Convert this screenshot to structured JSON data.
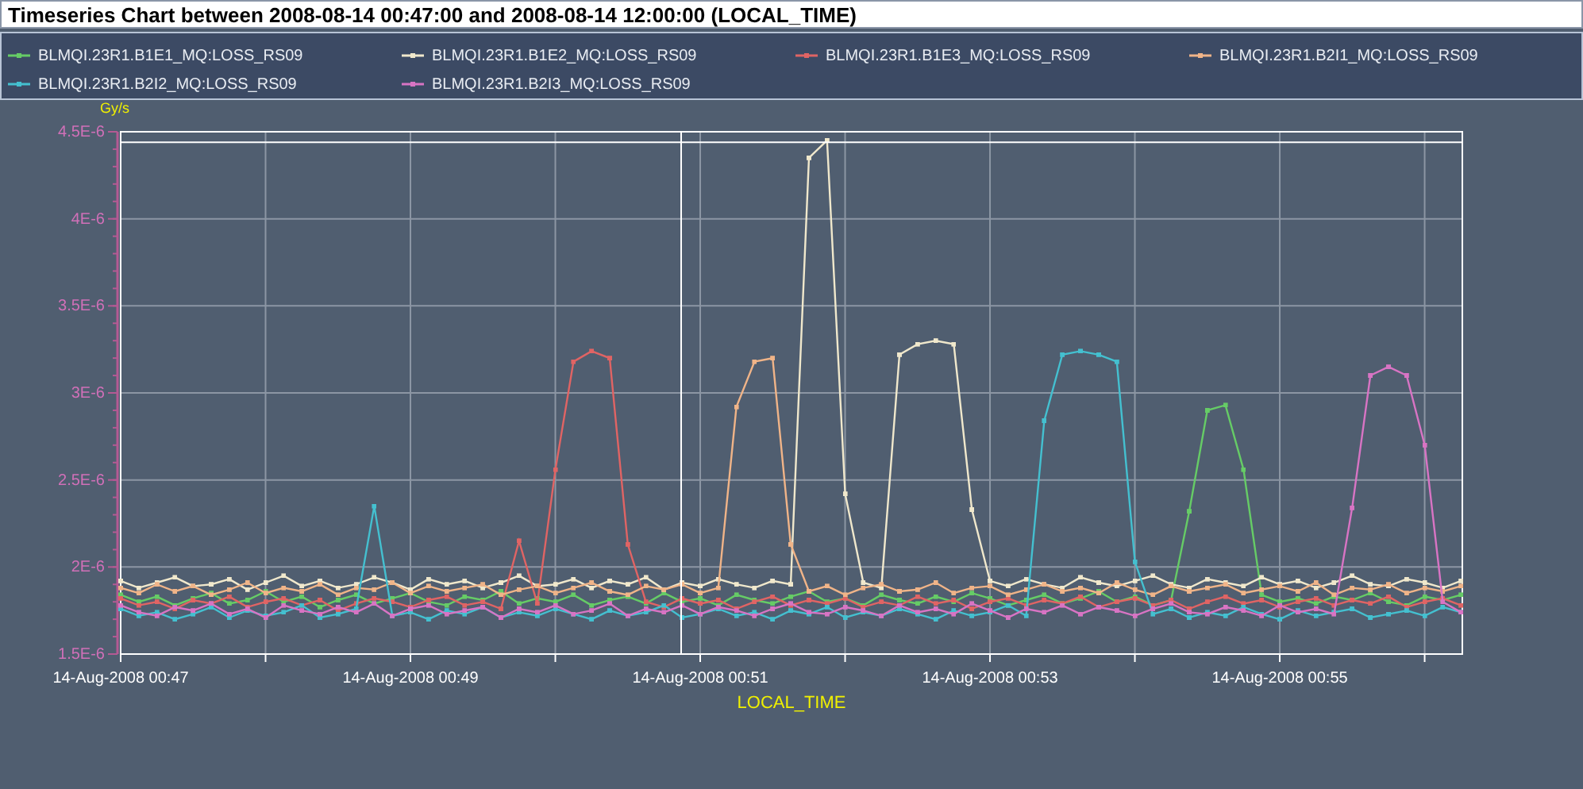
{
  "title": "Timeseries Chart between 2008-08-14 00:47:00 and 2008-08-14 12:00:00 (LOCAL_TIME)",
  "chart_data": {
    "type": "line",
    "xlabel": "LOCAL_TIME",
    "ylabel": "Gy/s",
    "ylim": [
      1.5e-06,
      4.5e-06
    ],
    "yticks": [
      {
        "value": 1.5e-06,
        "label": "1.5E-6"
      },
      {
        "value": 2e-06,
        "label": "2E-6"
      },
      {
        "value": 2.5e-06,
        "label": "2.5E-6"
      },
      {
        "value": 3e-06,
        "label": "3E-6"
      },
      {
        "value": 3.5e-06,
        "label": "3.5E-6"
      },
      {
        "value": 4e-06,
        "label": "4E-6"
      },
      {
        "value": 4.5e-06,
        "label": "4.5E-6"
      }
    ],
    "grid": true,
    "ref_lines": [
      {
        "axis": "y",
        "value": 4.44e-06
      }
    ],
    "categories": [
      "14-Aug-2008 00:47",
      null,
      null,
      null,
      null,
      null,
      null,
      null,
      null,
      null,
      null,
      null,
      null,
      null,
      null,
      null,
      "14-Aug-2008 00:49",
      null,
      null,
      null,
      null,
      null,
      null,
      null,
      null,
      null,
      null,
      null,
      null,
      null,
      null,
      null,
      "14-Aug-2008 00:51",
      null,
      null,
      null,
      null,
      null,
      null,
      null,
      null,
      null,
      null,
      null,
      null,
      null,
      null,
      null,
      "14-Aug-2008 00:53",
      null,
      null,
      null,
      null,
      null,
      null,
      null,
      null,
      null,
      null,
      null,
      null,
      null,
      null,
      null,
      "14-Aug-2008 00:55",
      null,
      null,
      null,
      null,
      null,
      null,
      null,
      null,
      null,
      null
    ],
    "series": [
      {
        "name": "BLMQI.23R1.B1E1_MQ:LOSS_RS09",
        "color": "#66cc66",
        "values": [
          1.84e-06,
          1.8e-06,
          1.83e-06,
          1.78e-06,
          1.82e-06,
          1.85e-06,
          1.79e-06,
          1.81e-06,
          1.86e-06,
          1.8e-06,
          1.83e-06,
          1.77e-06,
          1.81e-06,
          1.84e-06,
          1.79e-06,
          1.82e-06,
          1.85e-06,
          1.8e-06,
          1.78e-06,
          1.83e-06,
          1.81e-06,
          1.86e-06,
          1.79e-06,
          1.82e-06,
          1.8e-06,
          1.84e-06,
          1.78e-06,
          1.81e-06,
          1.83e-06,
          1.79e-06,
          1.85e-06,
          1.8e-06,
          1.82e-06,
          1.78e-06,
          1.84e-06,
          1.81e-06,
          1.79e-06,
          1.83e-06,
          1.86e-06,
          1.8e-06,
          1.82e-06,
          1.78e-06,
          1.84e-06,
          1.81e-06,
          1.79e-06,
          1.83e-06,
          1.8e-06,
          1.85e-06,
          1.82e-06,
          1.78e-06,
          1.81e-06,
          1.84e-06,
          1.79e-06,
          1.82e-06,
          1.86e-06,
          1.8e-06,
          1.83e-06,
          1.78e-06,
          1.81e-06,
          2.32e-06,
          2.9e-06,
          2.93e-06,
          2.56e-06,
          1.84e-06,
          1.8e-06,
          1.82e-06,
          1.79e-06,
          1.83e-06,
          1.81e-06,
          1.85e-06,
          1.8e-06,
          1.78e-06,
          1.83e-06,
          1.81e-06,
          1.84e-06
        ]
      },
      {
        "name": "BLMQI.23R1.B1E2_MQ:LOSS_RS09",
        "color": "#f0e8cc",
        "values": [
          1.92e-06,
          1.88e-06,
          1.91e-06,
          1.94e-06,
          1.89e-06,
          1.9e-06,
          1.93e-06,
          1.87e-06,
          1.91e-06,
          1.95e-06,
          1.89e-06,
          1.92e-06,
          1.88e-06,
          1.9e-06,
          1.94e-06,
          1.91e-06,
          1.87e-06,
          1.93e-06,
          1.9e-06,
          1.92e-06,
          1.88e-06,
          1.91e-06,
          1.95e-06,
          1.89e-06,
          1.9e-06,
          1.93e-06,
          1.88e-06,
          1.92e-06,
          1.9e-06,
          1.94e-06,
          1.87e-06,
          1.91e-06,
          1.89e-06,
          1.93e-06,
          1.9e-06,
          1.88e-06,
          1.92e-06,
          1.9e-06,
          4.35e-06,
          4.45e-06,
          2.42e-06,
          1.91e-06,
          1.88e-06,
          3.22e-06,
          3.28e-06,
          3.3e-06,
          3.28e-06,
          2.33e-06,
          1.92e-06,
          1.89e-06,
          1.93e-06,
          1.9e-06,
          1.88e-06,
          1.94e-06,
          1.91e-06,
          1.89e-06,
          1.92e-06,
          1.95e-06,
          1.9e-06,
          1.88e-06,
          1.93e-06,
          1.91e-06,
          1.89e-06,
          1.94e-06,
          1.9e-06,
          1.92e-06,
          1.88e-06,
          1.91e-06,
          1.95e-06,
          1.9e-06,
          1.89e-06,
          1.93e-06,
          1.91e-06,
          1.88e-06,
          1.92e-06
        ]
      },
      {
        "name": "BLMQI.23R1.B1E3_MQ:LOSS_RS09",
        "color": "#e06464",
        "values": [
          1.82e-06,
          1.78e-06,
          1.8e-06,
          1.76e-06,
          1.81e-06,
          1.79e-06,
          1.83e-06,
          1.77e-06,
          1.8e-06,
          1.82e-06,
          1.78e-06,
          1.81e-06,
          1.75e-06,
          1.79e-06,
          1.82e-06,
          1.8e-06,
          1.77e-06,
          1.81e-06,
          1.83e-06,
          1.78e-06,
          1.8e-06,
          1.76e-06,
          2.15e-06,
          1.79e-06,
          2.56e-06,
          3.18e-06,
          3.24e-06,
          3.2e-06,
          2.13e-06,
          1.8e-06,
          1.77e-06,
          1.82e-06,
          1.79e-06,
          1.81e-06,
          1.76e-06,
          1.8e-06,
          1.83e-06,
          1.78e-06,
          1.81e-06,
          1.79e-06,
          1.82e-06,
          1.77e-06,
          1.8e-06,
          1.78e-06,
          1.83e-06,
          1.79e-06,
          1.81e-06,
          1.76e-06,
          1.8e-06,
          1.82e-06,
          1.78e-06,
          1.81e-06,
          1.79e-06,
          1.83e-06,
          1.77e-06,
          1.8e-06,
          1.82e-06,
          1.78e-06,
          1.81e-06,
          1.76e-06,
          1.8e-06,
          1.83e-06,
          1.79e-06,
          1.81e-06,
          1.77e-06,
          1.8e-06,
          1.82e-06,
          1.78e-06,
          1.81e-06,
          1.79e-06,
          1.83e-06,
          1.77e-06,
          1.8e-06,
          1.82e-06,
          1.78e-06
        ]
      },
      {
        "name": "BLMQI.23R1.B2I1_MQ:LOSS_RS09",
        "color": "#f0b488",
        "values": [
          1.88e-06,
          1.85e-06,
          1.9e-06,
          1.86e-06,
          1.89e-06,
          1.84e-06,
          1.87e-06,
          1.91e-06,
          1.85e-06,
          1.88e-06,
          1.86e-06,
          1.9e-06,
          1.84e-06,
          1.88e-06,
          1.87e-06,
          1.91e-06,
          1.85e-06,
          1.89e-06,
          1.86e-06,
          1.88e-06,
          1.9e-06,
          1.84e-06,
          1.87e-06,
          1.89e-06,
          1.85e-06,
          1.88e-06,
          1.91e-06,
          1.86e-06,
          1.84e-06,
          1.89e-06,
          1.87e-06,
          1.9e-06,
          1.85e-06,
          1.88e-06,
          2.92e-06,
          3.18e-06,
          3.2e-06,
          2.13e-06,
          1.86e-06,
          1.89e-06,
          1.84e-06,
          1.88e-06,
          1.9e-06,
          1.86e-06,
          1.87e-06,
          1.91e-06,
          1.85e-06,
          1.88e-06,
          1.89e-06,
          1.84e-06,
          1.87e-06,
          1.9e-06,
          1.86e-06,
          1.88e-06,
          1.85e-06,
          1.91e-06,
          1.87e-06,
          1.84e-06,
          1.89e-06,
          1.86e-06,
          1.88e-06,
          1.9e-06,
          1.85e-06,
          1.87e-06,
          1.89e-06,
          1.86e-06,
          1.91e-06,
          1.84e-06,
          1.88e-06,
          1.87e-06,
          1.9e-06,
          1.85e-06,
          1.88e-06,
          1.86e-06,
          1.89e-06
        ]
      },
      {
        "name": "BLMQI.23R1.B2I2_MQ:LOSS_RS09",
        "color": "#44c0d0",
        "values": [
          1.76e-06,
          1.72e-06,
          1.74e-06,
          1.7e-06,
          1.73e-06,
          1.77e-06,
          1.71e-06,
          1.75e-06,
          1.72e-06,
          1.74e-06,
          1.78e-06,
          1.71e-06,
          1.73e-06,
          1.76e-06,
          2.35e-06,
          1.72e-06,
          1.74e-06,
          1.7e-06,
          1.75e-06,
          1.73e-06,
          1.77e-06,
          1.71e-06,
          1.74e-06,
          1.72e-06,
          1.76e-06,
          1.73e-06,
          1.7e-06,
          1.75e-06,
          1.72e-06,
          1.74e-06,
          1.78e-06,
          1.71e-06,
          1.73e-06,
          1.76e-06,
          1.72e-06,
          1.74e-06,
          1.7e-06,
          1.75e-06,
          1.73e-06,
          1.77e-06,
          1.71e-06,
          1.74e-06,
          1.72e-06,
          1.76e-06,
          1.73e-06,
          1.7e-06,
          1.75e-06,
          1.72e-06,
          1.74e-06,
          1.78e-06,
          1.72e-06,
          2.84e-06,
          3.22e-06,
          3.24e-06,
          3.22e-06,
          3.18e-06,
          2.03e-06,
          1.73e-06,
          1.76e-06,
          1.71e-06,
          1.74e-06,
          1.72e-06,
          1.77e-06,
          1.73e-06,
          1.7e-06,
          1.75e-06,
          1.72e-06,
          1.74e-06,
          1.76e-06,
          1.71e-06,
          1.73e-06,
          1.75e-06,
          1.72e-06,
          1.77e-06,
          1.74e-06
        ]
      },
      {
        "name": "BLMQI.23R1.B2I3_MQ:LOSS_RS09",
        "color": "#d874c4",
        "values": [
          1.78e-06,
          1.74e-06,
          1.72e-06,
          1.77e-06,
          1.75e-06,
          1.79e-06,
          1.73e-06,
          1.76e-06,
          1.71e-06,
          1.78e-06,
          1.75e-06,
          1.73e-06,
          1.77e-06,
          1.74e-06,
          1.79e-06,
          1.72e-06,
          1.76e-06,
          1.78e-06,
          1.73e-06,
          1.75e-06,
          1.77e-06,
          1.71e-06,
          1.76e-06,
          1.74e-06,
          1.78e-06,
          1.73e-06,
          1.75e-06,
          1.79e-06,
          1.72e-06,
          1.76e-06,
          1.74e-06,
          1.78e-06,
          1.73e-06,
          1.77e-06,
          1.75e-06,
          1.72e-06,
          1.76e-06,
          1.79e-06,
          1.74e-06,
          1.73e-06,
          1.77e-06,
          1.75e-06,
          1.72e-06,
          1.78e-06,
          1.74e-06,
          1.76e-06,
          1.73e-06,
          1.79e-06,
          1.75e-06,
          1.71e-06,
          1.76e-06,
          1.74e-06,
          1.78e-06,
          1.73e-06,
          1.77e-06,
          1.75e-06,
          1.72e-06,
          1.76e-06,
          1.79e-06,
          1.74e-06,
          1.73e-06,
          1.77e-06,
          1.75e-06,
          1.72e-06,
          1.78e-06,
          1.74e-06,
          1.76e-06,
          1.73e-06,
          2.34e-06,
          3.1e-06,
          3.15e-06,
          3.1e-06,
          2.7e-06,
          1.8e-06,
          1.74e-06
        ]
      }
    ]
  }
}
